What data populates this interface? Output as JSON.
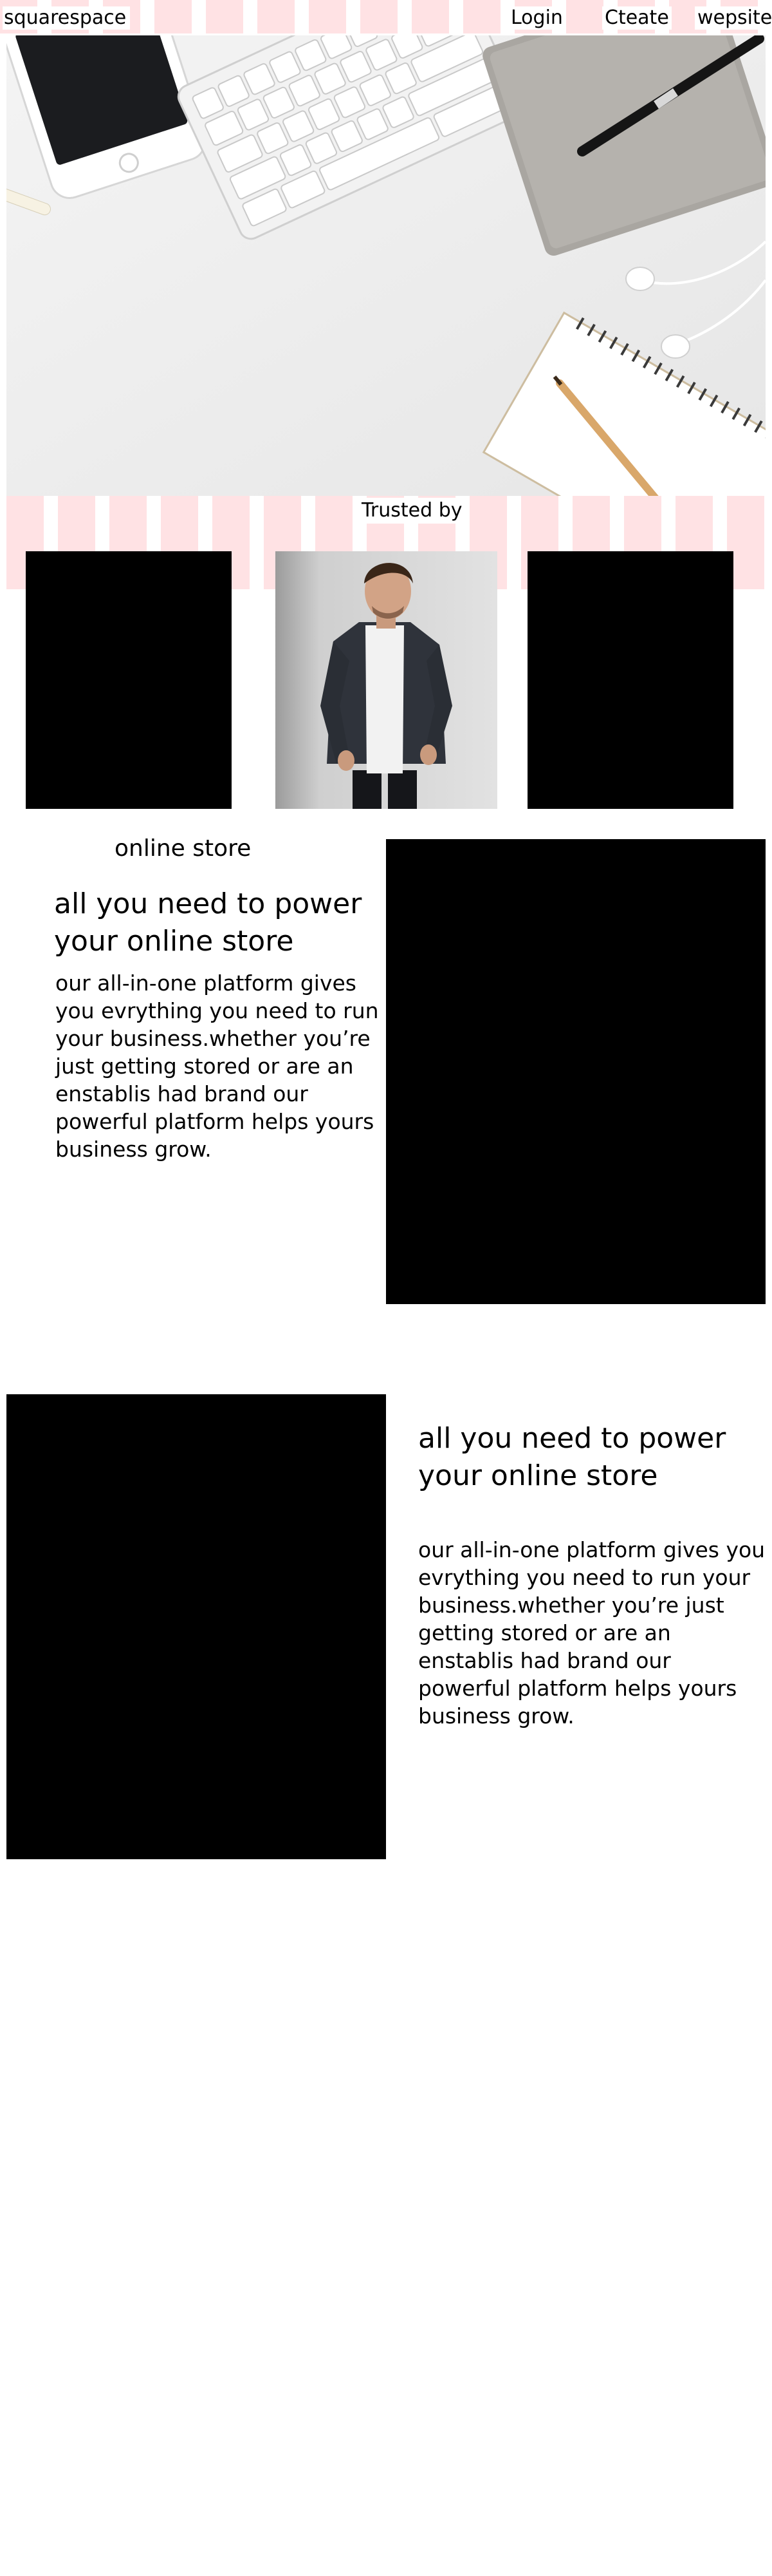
{
  "nav": {
    "brand": "squarespace",
    "links": [
      "Login",
      "Cteate",
      "wepsite"
    ]
  },
  "trusted": {
    "label": "Trusted by"
  },
  "section1": {
    "kicker": "online store",
    "heading": "all you need to power\n your  online  store",
    "body": "our all-in-one platform gives you evrything you need to run your business.whether you’re just getting stored or are an enstablis had brand our powerful platform helps yours business grow."
  },
  "section2": {
    "heading": "all you need to power\n your  online  store",
    "body": "our all-in-one platform gives you evrything you need to run your business.whether you’re just getting stored or are an enstablis had brand our powerful platform helps yours business grow."
  },
  "colors": {
    "stripe_pink": "#ffe2e4",
    "block_black": "#000000",
    "background": "#ffffff"
  }
}
